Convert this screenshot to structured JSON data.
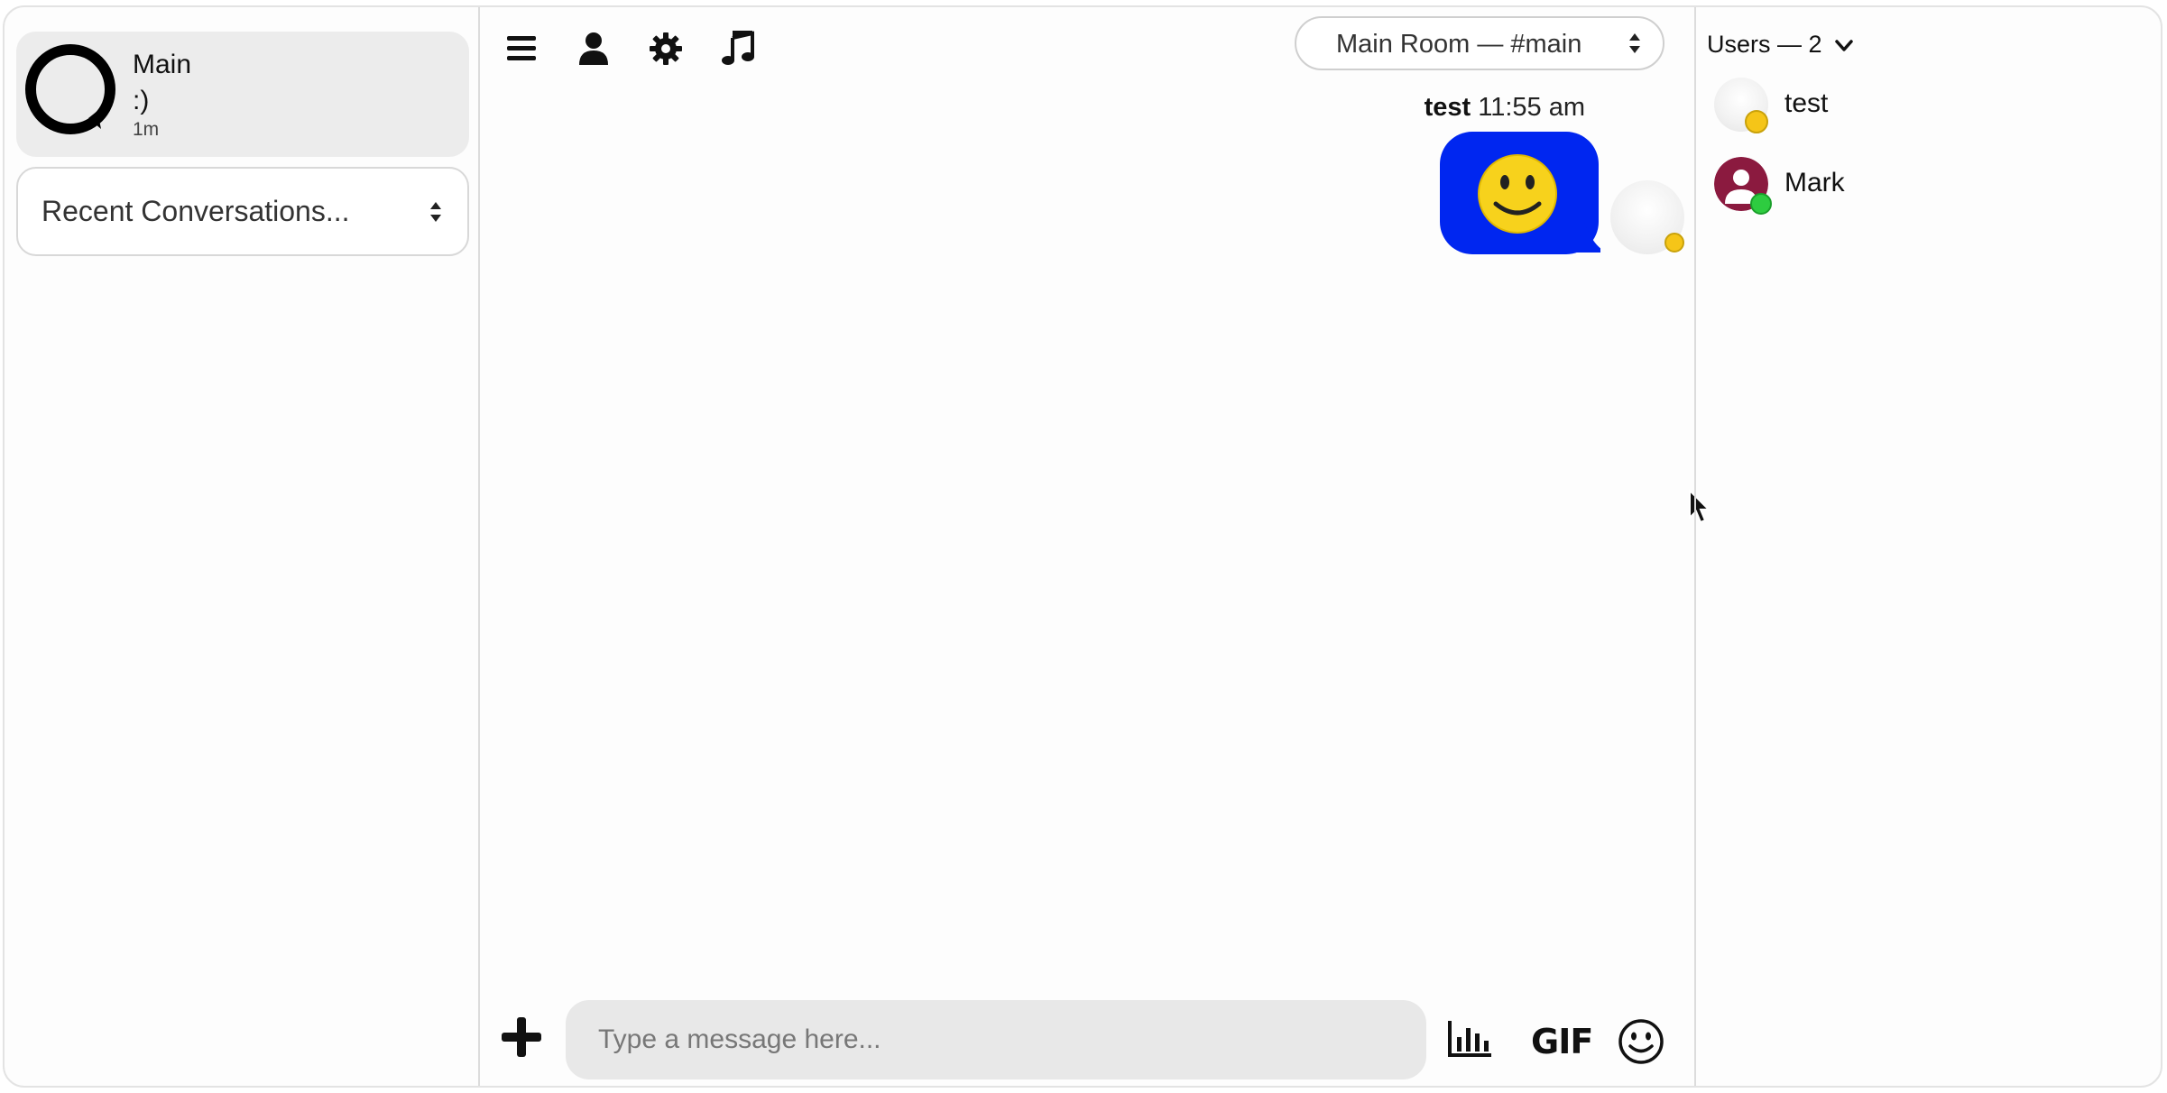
{
  "conversation": {
    "title": "Main",
    "last_message": ":)",
    "time_ago": "1m"
  },
  "recent": {
    "label": "Recent Conversations..."
  },
  "toolbar": {
    "icons": [
      "menu-icon",
      "user-icon",
      "gear-icon",
      "music-note-icon"
    ]
  },
  "room": {
    "label": "Main Room — #main"
  },
  "message": {
    "sender": "test",
    "time": "11:55 am",
    "content": "smiley-emoji"
  },
  "composer": {
    "placeholder": "Type a message here...",
    "gif_label": "GIF"
  },
  "users": {
    "header": "Users — 2",
    "list": [
      {
        "name": "test",
        "status": "away"
      },
      {
        "name": "Mark",
        "status": "online"
      }
    ]
  },
  "colors": {
    "bubble": "#0026f0",
    "away": "#f5c518",
    "online": "#2ecc40",
    "mark_avatar": "#8b1a3f"
  }
}
